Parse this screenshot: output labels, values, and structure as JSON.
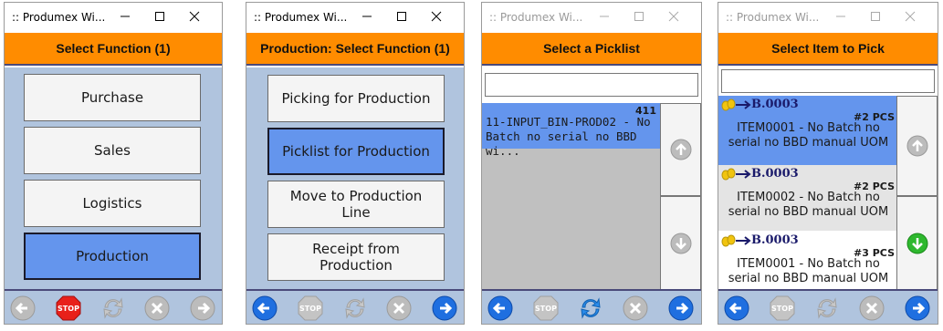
{
  "colors": {
    "accent": "#ff8c00",
    "selected": "#6495ed",
    "panel": "#b0c4de"
  },
  "windows": [
    {
      "title": ":: Produmex Wi...",
      "header": "Select Function (1)",
      "menu": [
        "Purchase",
        "Sales",
        "Logistics",
        "Production"
      ],
      "toolbar": [
        "back-icon",
        "stop-icon",
        "sync-icon",
        "cancel-icon",
        "forward-icon"
      ],
      "stop_label": "STOP"
    },
    {
      "title": ":: Produmex Wi...",
      "header": "Production: Select Function (1)",
      "menu": [
        "Picking for Production",
        "Picklist for Production",
        "Move to Production Line",
        "Receipt from Production"
      ],
      "toolbar": [
        "back-icon",
        "stop-icon",
        "sync-icon",
        "cancel-icon",
        "forward-icon"
      ],
      "stop_label": "STOP"
    },
    {
      "title": ":: Produmex Wi...",
      "header": "Select a Picklist",
      "search": {
        "value": "",
        "placeholder": ""
      },
      "list": [
        {
          "number": "411",
          "text": "11-INPUT_BIN-PROD02 - No Batch no serial no BBD wi..."
        }
      ],
      "toolbar": [
        "back-icon",
        "stop-icon",
        "sync-icon",
        "cancel-icon",
        "forward-icon"
      ],
      "stop_label": "STOP"
    },
    {
      "title": ":: Produmex Wi...",
      "header": "Select Item to Pick",
      "search": {
        "value": "",
        "placeholder": ""
      },
      "items": [
        {
          "bin": "B.0003",
          "qty": "#2 PCS",
          "text": "ITEM0001 - No Batch no serial no BBD manual UOM"
        },
        {
          "bin": "B.0003",
          "qty": "#2 PCS",
          "text": "ITEM0002 - No Batch no serial no BBD manual UOM"
        },
        {
          "bin": "B.0003",
          "qty": "#3 PCS",
          "text": "ITEM0001 - No Batch no serial no BBD manual UOM"
        }
      ],
      "toolbar": [
        "back-icon",
        "stop-icon",
        "sync-icon",
        "cancel-icon",
        "forward-icon"
      ],
      "stop_label": "STOP"
    }
  ]
}
